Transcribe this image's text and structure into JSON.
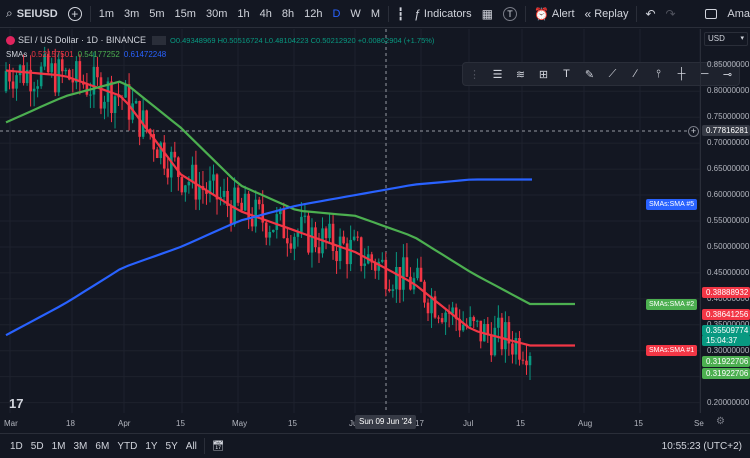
{
  "topbar": {
    "symbol": "SEIUSD",
    "intervals": [
      "1m",
      "3m",
      "5m",
      "15m",
      "30m",
      "1h",
      "4h",
      "8h",
      "12h",
      "D",
      "W",
      "M"
    ],
    "active_interval": "D",
    "indicators_label": "Indicators",
    "alert_label": "Alert",
    "replay_label": "Replay",
    "right_label": "Ama",
    "currency": "USD"
  },
  "legend": {
    "title": "SEI / US Dollar · 1D · BINANCE",
    "ohlc": "O0.49348969 H0.50516724 L0.48104223 C0.50212920 +0.00862904 (+1.75%)",
    "sma_label": "SMAs",
    "sma_values": [
      "0.52157501",
      "0.54177252",
      "0.61472248"
    ],
    "sma_colors": [
      "#f23645",
      "#4caf50",
      "#2962ff"
    ]
  },
  "price_scale": {
    "ticks": [
      "0.85000000",
      "0.80000000",
      "0.75000000",
      "0.70000000",
      "0.65000000",
      "0.60000000",
      "0.55000000",
      "0.50000000",
      "0.45000000",
      "0.40000000",
      "0.35000000",
      "0.30000000",
      "0.25000000",
      "0.20000000"
    ],
    "crosshair_price": "0.77816281",
    "labels": [
      {
        "text": "0.38888932",
        "color": "#f23645"
      },
      {
        "text": "0.38641256",
        "color": "#f23645"
      },
      {
        "text": "0.35509774",
        "color": "#089981"
      },
      {
        "text": "15:04:37",
        "color": "#089981"
      },
      {
        "text": "0.31922706",
        "color": "#4caf50"
      },
      {
        "text": "0.31922706",
        "color": "#4caf50"
      }
    ]
  },
  "time_scale": {
    "ticks": [
      "Mar",
      "18",
      "Apr",
      "15",
      "May",
      "15",
      "Ju",
      "17",
      "Jul",
      "15",
      "Aug",
      "15",
      "Se"
    ],
    "crosshair_time": "Sun 09 Jun '24"
  },
  "sma_tags": [
    {
      "text": "SMAs:SMA #5",
      "color": "#2962ff"
    },
    {
      "text": "SMAs:SMA #2",
      "color": "#4caf50"
    },
    {
      "text": "SMAs:SMA #1",
      "color": "#f23645"
    }
  ],
  "bottombar": {
    "ranges": [
      "1D",
      "5D",
      "1M",
      "3M",
      "6M",
      "YTD",
      "1Y",
      "5Y",
      "All"
    ],
    "clock": "10:55:23 (UTC+2)"
  },
  "chart_data": {
    "type": "line",
    "title": "SEI / US Dollar · 1D · BINANCE",
    "ylim": [
      0.18,
      0.92
    ],
    "x": [
      "Mar",
      "18",
      "Apr",
      "15",
      "May",
      "15",
      "Jun",
      "17",
      "Jul",
      "15"
    ],
    "series": [
      {
        "name": "SMA #1",
        "color": "#f23645",
        "values": [
          0.84,
          0.83,
          0.79,
          0.64,
          0.57,
          0.53,
          0.49,
          0.43,
          0.34,
          0.31
        ]
      },
      {
        "name": "SMA #2",
        "color": "#4caf50",
        "values": [
          0.74,
          0.79,
          0.82,
          0.73,
          0.62,
          0.57,
          0.56,
          0.52,
          0.45,
          0.39
        ]
      },
      {
        "name": "SMA #5",
        "color": "#2962ff",
        "values": [
          0.33,
          0.39,
          0.46,
          0.5,
          0.55,
          0.58,
          0.6,
          0.62,
          0.63,
          0.63
        ]
      }
    ],
    "grid": true
  }
}
